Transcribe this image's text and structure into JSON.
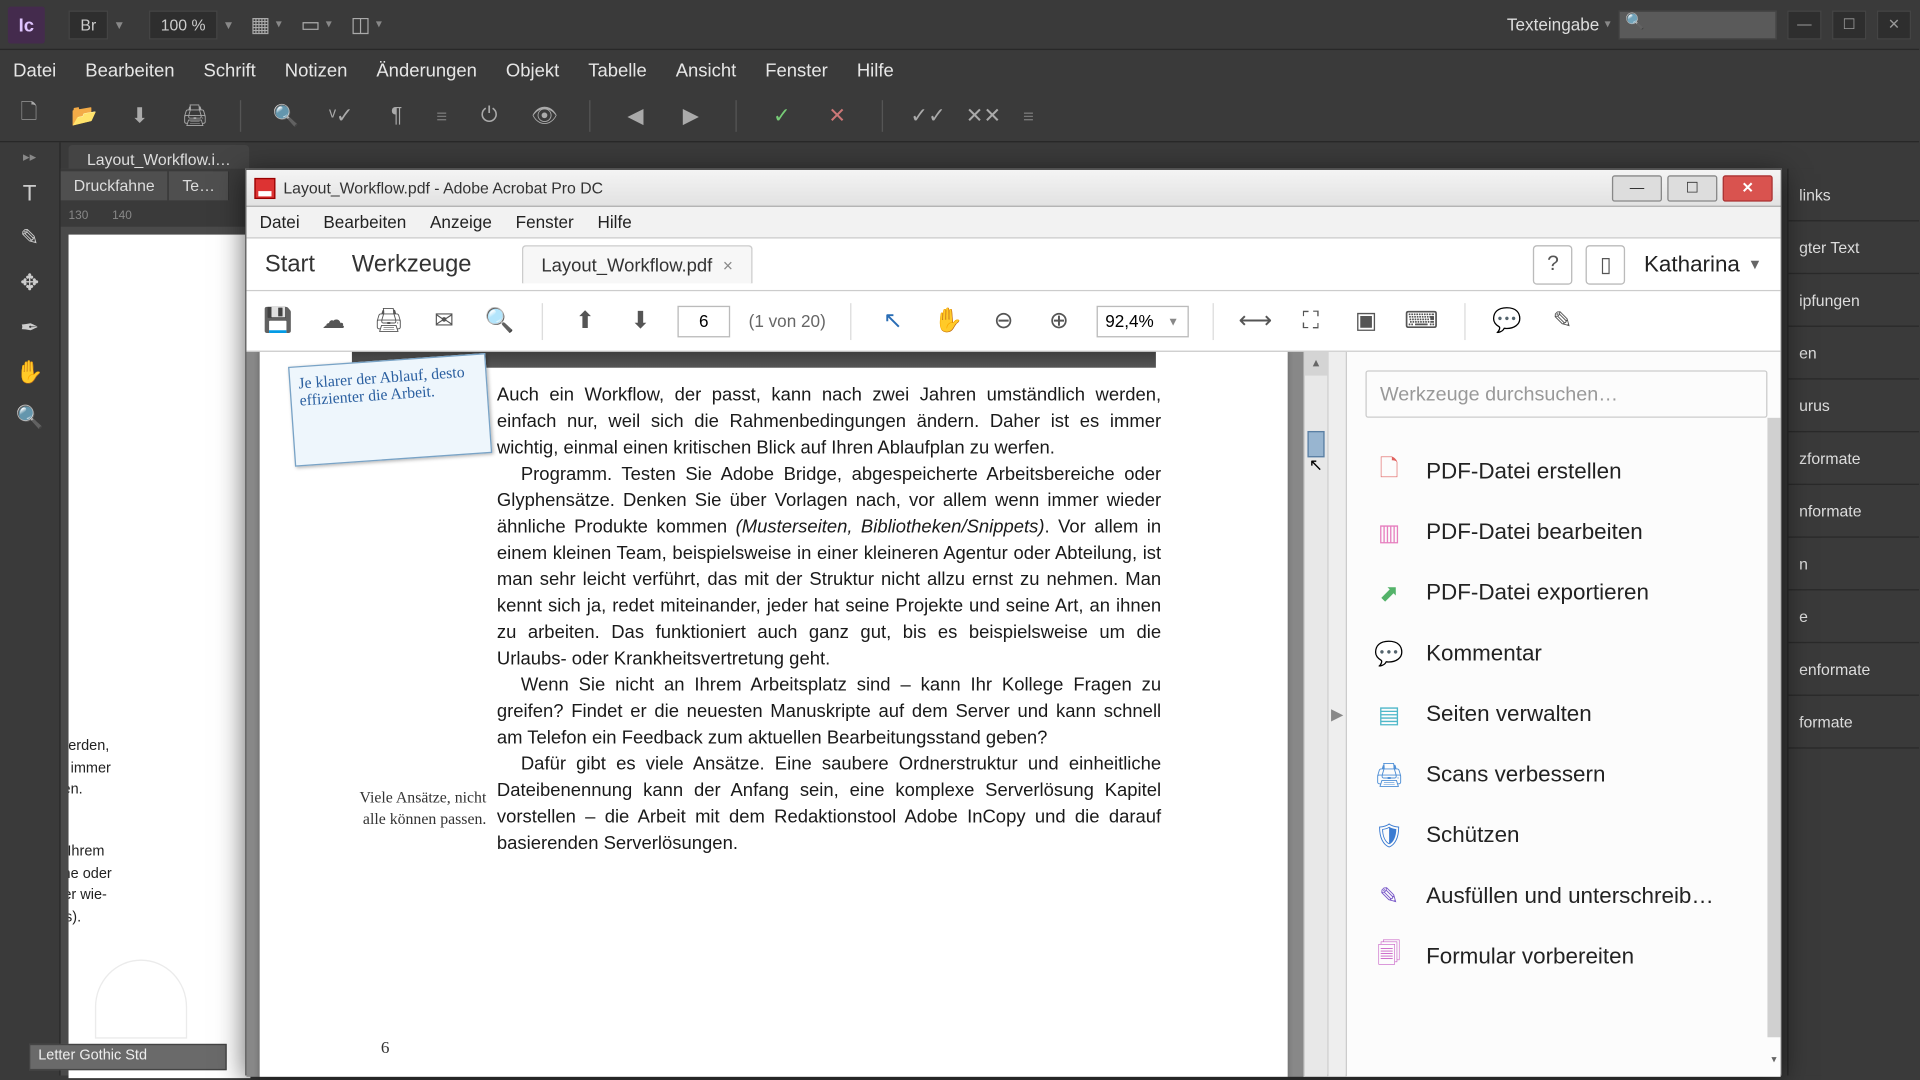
{
  "incopy": {
    "logo_text": "Ic",
    "br_box": "Br",
    "zoom": "100 %",
    "mode_label": "Texteingabe",
    "menu": [
      "Datei",
      "Bearbeiten",
      "Schrift",
      "Notizen",
      "Änderungen",
      "Objekt",
      "Tabelle",
      "Ansicht",
      "Fenster",
      "Hilfe"
    ],
    "doc_tab": "Layout_Workflow.i…",
    "view_mode": "Druckfahne",
    "view_mode2": "Te…",
    "ruler_ticks": [
      "130",
      "140"
    ],
    "peek_para1": "ndlich werden,\ner ist es immer\nzu werfen.",
    "peek_para2": "ngen in Ihrem\nsbereiche oder\nnn immer wie-\nSnippets).",
    "font_field": "Letter Gothic Std",
    "right_panels": [
      "links",
      "gter Text",
      "ipfungen",
      "en",
      "urus",
      "zformate",
      "nformate",
      "n",
      "e",
      "enformate",
      "formate"
    ]
  },
  "acrobat": {
    "window_title": "Layout_Workflow.pdf - Adobe Acrobat Pro DC",
    "menu": [
      "Datei",
      "Bearbeiten",
      "Anzeige",
      "Fenster",
      "Hilfe"
    ],
    "tabs": {
      "start": "Start",
      "tools": "Werkzeuge",
      "doc": "Layout_Workflow.pdf"
    },
    "user": "Katharina",
    "page_field": "6",
    "page_count": "(1 von 20)",
    "zoom": "92,4%",
    "sticky_note": "Je klarer der Ablauf, desto effizienter die Arbeit.",
    "body_p1": "Auch ein Workflow, der passt, kann nach zwei Jahren umständlich werden, einfach nur, weil sich die Rahmenbedingungen ändern. Daher ist es immer wichtig, einmal einen kritischen Blick auf Ihren Ablaufplan zu werfen.",
    "body_p2": "Programm. Testen Sie Adobe Bridge, abgespeicherte Arbeitsbereiche oder Glyphensätze. Denken Sie über Vorlagen nach, vor allem wenn immer wieder ähnliche Produkte kommen ",
    "body_p2_em": "(Musterseiten, Bibliotheken/Snippets)",
    "body_p2_tail": ". Vor allem in einem kleinen Team, beispielsweise in einer kleineren Agentur oder Abteilung, ist man sehr leicht verführt, das mit der Struktur nicht allzu ernst zu nehmen. Man kennt sich ja, redet miteinander, jeder hat seine Projekte und seine Art, an ihnen zu arbeiten. Das funktioniert auch ganz gut, bis es beispielsweise um die Urlaubs- oder Krankheitsvertretung geht.",
    "body_p3": "Wenn Sie nicht an Ihrem Arbeitsplatz sind – kann Ihr Kollege Fragen zu greifen? Findet er die neuesten Manuskripte auf dem Server und kann schnell am Telefon ein Feedback zum aktuellen Bearbeitungsstand geben?",
    "body_p4": "Dafür gibt es viele Ansätze. Eine saubere Ordnerstruktur und einheitliche Dateibenennung kann der Anfang sein, eine komplexe Serverlösung Kapitel vorstellen – die Arbeit mit dem Redaktionstool Adobe InCopy und die darauf basierenden Serverlösungen.",
    "side_note": "Viele Ansätze, nicht alle können passen.",
    "page_number": "6",
    "search_placeholder": "Werkzeuge durchsuchen…",
    "tools": [
      {
        "label": "PDF-Datei erstellen",
        "color": "#e0615e",
        "glyph": "🗋"
      },
      {
        "label": "PDF-Datei bearbeiten",
        "color": "#e67fbf",
        "glyph": "▥"
      },
      {
        "label": "PDF-Datei exportieren",
        "color": "#54b36a",
        "glyph": "⬈"
      },
      {
        "label": "Kommentar",
        "color": "#e3b23c",
        "glyph": "💬"
      },
      {
        "label": "Seiten verwalten",
        "color": "#4fb8c9",
        "glyph": "▤"
      },
      {
        "label": "Scans verbessern",
        "color": "#4f8fd6",
        "glyph": "🖨"
      },
      {
        "label": "Schützen",
        "color": "#3b7bd1",
        "glyph": "🛡"
      },
      {
        "label": "Ausfüllen und unterschreib…",
        "color": "#7a59c9",
        "glyph": "✎"
      },
      {
        "label": "Formular vorbereiten",
        "color": "#c75ec5",
        "glyph": "🗐"
      }
    ]
  }
}
